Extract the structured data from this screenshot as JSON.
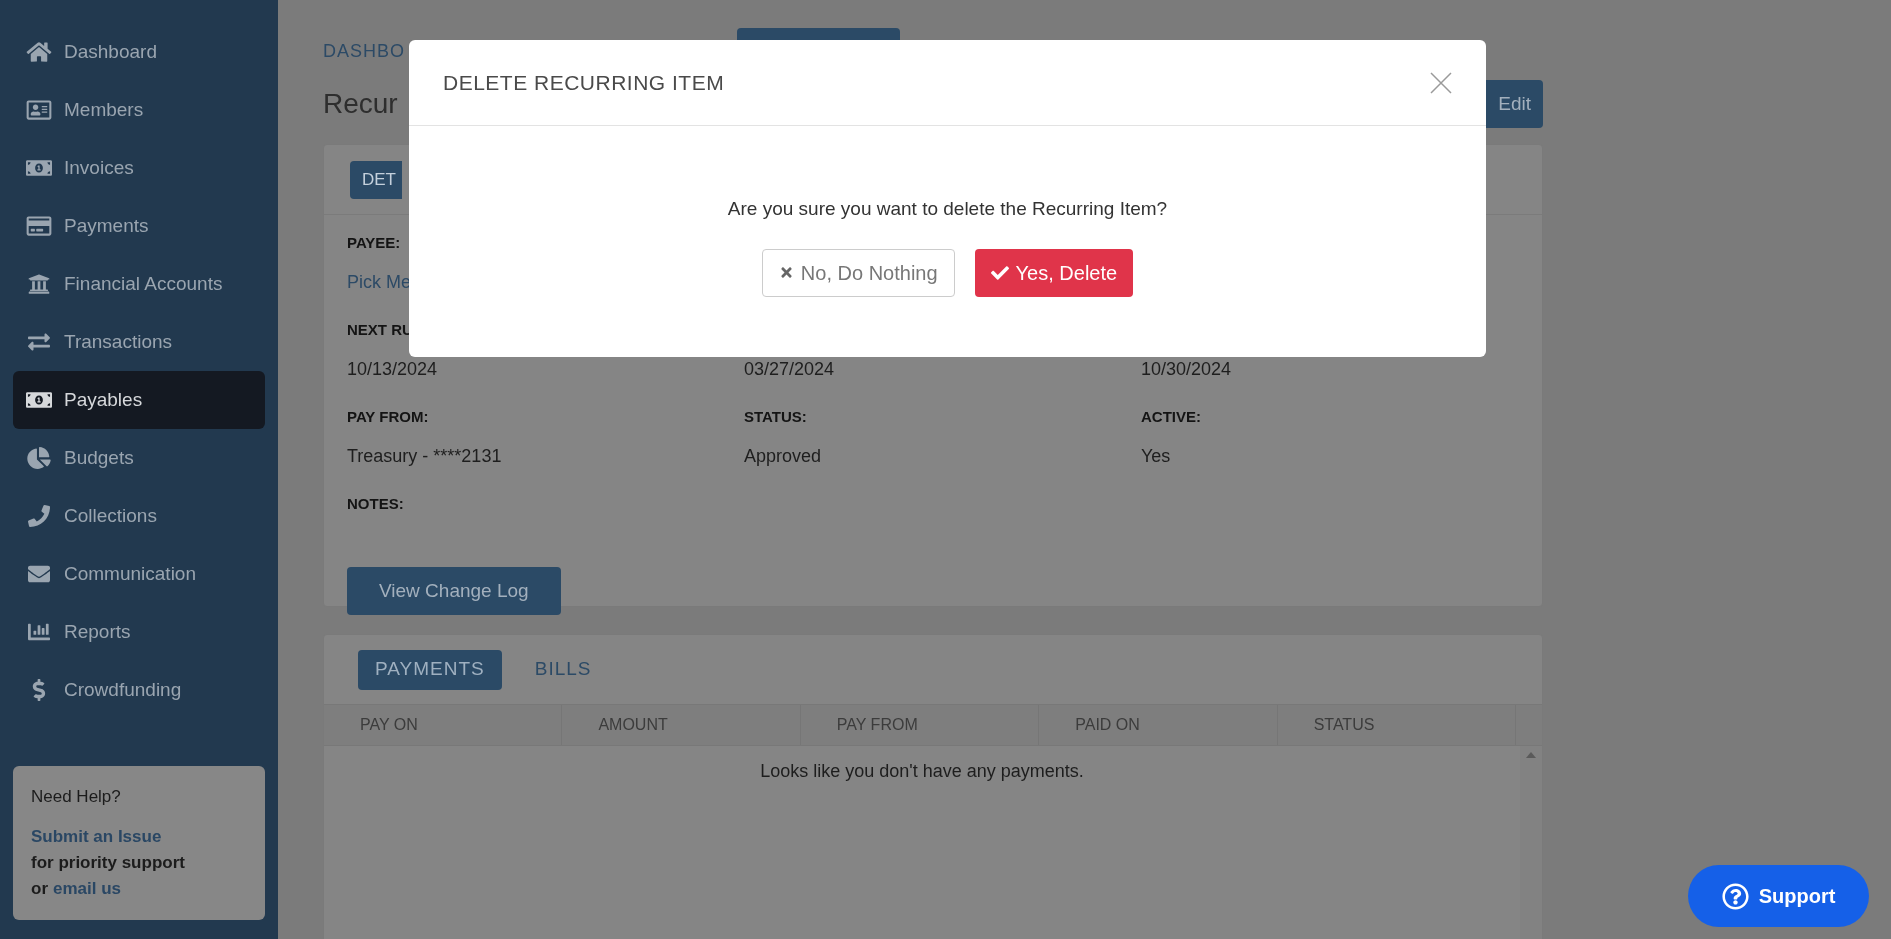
{
  "sidebar": {
    "items": [
      {
        "label": "Dashboard",
        "selected": false
      },
      {
        "label": "Members",
        "selected": false
      },
      {
        "label": "Invoices",
        "selected": false
      },
      {
        "label": "Payments",
        "selected": false
      },
      {
        "label": "Financial Accounts",
        "selected": false
      },
      {
        "label": "Transactions",
        "selected": false
      },
      {
        "label": "Payables",
        "selected": true
      },
      {
        "label": "Budgets",
        "selected": false
      },
      {
        "label": "Collections",
        "selected": false
      },
      {
        "label": "Communication",
        "selected": false
      },
      {
        "label": "Reports",
        "selected": false
      },
      {
        "label": "Crowdfunding",
        "selected": false
      }
    ],
    "help": {
      "title": "Need Help?",
      "link": "Submit an Issue",
      "text": "for priority support",
      "prefix": "or",
      "link2": "email us"
    }
  },
  "breadcrumb": "DASHBO",
  "title": "Recur",
  "edit_button": "Edit",
  "details": {
    "tab": "DET",
    "rows": [
      [
        {
          "label": "PAYEE:",
          "value": "Pick Me",
          "kind": "link"
        }
      ],
      [
        {
          "label": "NEXT RU",
          "value": "10/13/2024"
        },
        {
          "value": "03/27/2024"
        },
        {
          "value": "10/30/2024"
        }
      ],
      [
        {
          "label": "PAY FROM:",
          "value": "Treasury - ****2131"
        },
        {
          "label": "STATUS:",
          "value": "Approved"
        },
        {
          "label": "ACTIVE:",
          "value": "Yes"
        }
      ],
      [
        {
          "label": "NOTES:"
        }
      ]
    ],
    "change_log_button": "View Change Log"
  },
  "payments": {
    "tabs": [
      {
        "label": "PAYMENTS",
        "selected": true
      },
      {
        "label": "BILLS",
        "selected": false
      }
    ],
    "columns": [
      "PAY ON",
      "AMOUNT",
      "PAY FROM",
      "PAID ON",
      "STATUS"
    ],
    "empty_text": "Looks like you don't have any payments."
  },
  "modal": {
    "title": "DELETE RECURRING ITEM",
    "message": "Are you sure you want to delete the Recurring Item?",
    "buttons": [
      {
        "label": "No, Do Nothing",
        "kind": "cancel"
      },
      {
        "label": "Yes, Delete",
        "kind": "danger"
      }
    ]
  },
  "support_button": "Support"
}
